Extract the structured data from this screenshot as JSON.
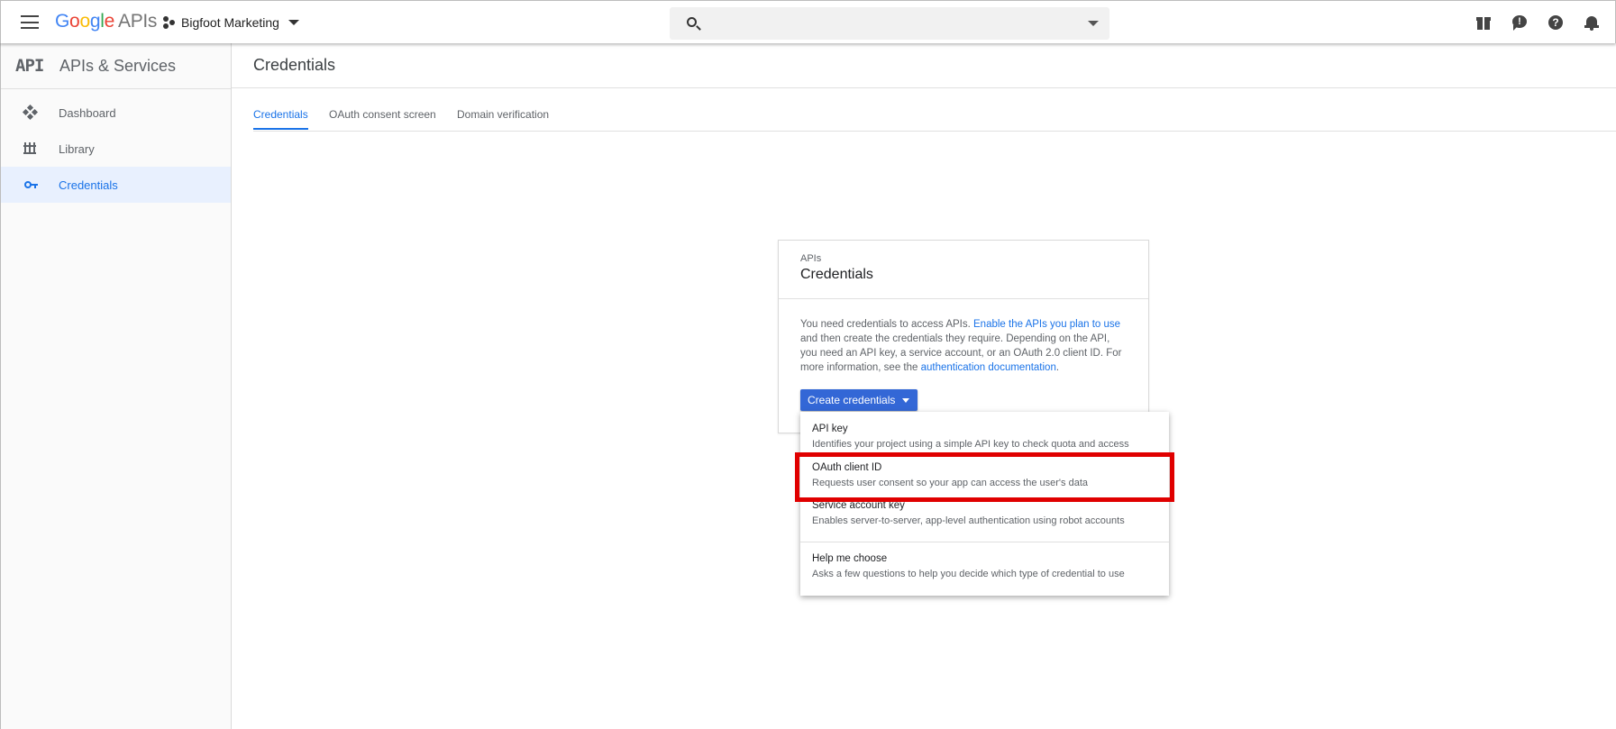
{
  "topbar": {
    "logo": {
      "letters": [
        "G",
        "o",
        "o",
        "g",
        "l",
        "e"
      ],
      "suffix": "APIs"
    },
    "project_name": "Bigfoot Marketing",
    "search": {
      "placeholder": "",
      "value": ""
    },
    "icons": [
      "menu-icon",
      "project-icon",
      "search-icon",
      "gift-icon",
      "feedback-icon",
      "help-icon",
      "bell-icon"
    ]
  },
  "sidebar": {
    "title": "APIs & Services",
    "mark": "API",
    "items": [
      {
        "label": "Dashboard",
        "icon": "dashboard-icon",
        "active": false
      },
      {
        "label": "Library",
        "icon": "library-icon",
        "active": false
      },
      {
        "label": "Credentials",
        "icon": "key-icon",
        "active": true
      }
    ]
  },
  "main": {
    "title": "Credentials",
    "tabs": [
      {
        "label": "Credentials",
        "active": true
      },
      {
        "label": "OAuth consent screen",
        "active": false
      },
      {
        "label": "Domain verification",
        "active": false
      }
    ]
  },
  "card": {
    "kicker": "APIs",
    "title": "Credentials",
    "body": {
      "t1": "You need credentials to access APIs. ",
      "link1": "Enable the APIs you plan to use",
      "t2": " and then create the credentials they require. Depending on the API, you need an API key, a service account, or an OAuth 2.0 client ID. For more information, see the ",
      "link2": "authentication documentation",
      "t3": "."
    },
    "button_label": "Create credentials"
  },
  "menu": {
    "items": [
      {
        "title": "API key",
        "desc": "Identifies your project using a simple API key to check quota and access"
      },
      {
        "title": "OAuth client ID",
        "desc": "Requests user consent so your app can access the user's data"
      },
      {
        "title": "Service account key",
        "desc": "Enables server-to-server, app-level authentication using robot accounts"
      },
      {
        "title": "Help me choose",
        "desc": "Asks a few questions to help you decide which type of credential to use"
      }
    ],
    "highlighted": "OAuth client ID",
    "highlight_color": "#e00000"
  },
  "colors": {
    "accent": "#1a73e8",
    "button": "#3367d6"
  }
}
